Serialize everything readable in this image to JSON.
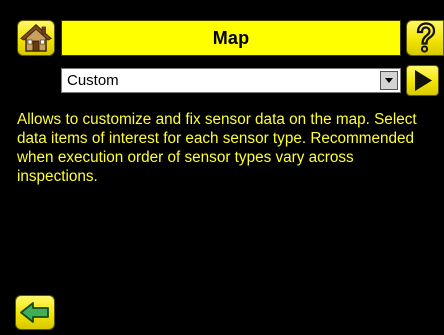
{
  "header": {
    "title": "Map",
    "home_icon": "home-icon",
    "help_icon": "help-icon"
  },
  "selector": {
    "value": "Custom",
    "arrow_icon": "chevron-down-icon",
    "go_icon": "arrow-right-icon"
  },
  "description": "Allows to customize and fix sensor data on the map. Select data items of interest for each sensor type. Recommended when execution order of sensor types vary across inspections.",
  "footer": {
    "back_icon": "arrow-left-icon"
  },
  "colors": {
    "accent": "#ffff00",
    "text": "#ffff33",
    "background": "#000000"
  }
}
